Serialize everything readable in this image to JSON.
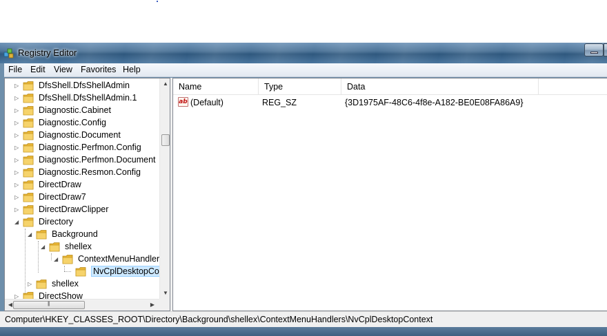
{
  "window": {
    "title": "Registry Editor"
  },
  "menu": [
    "File",
    "Edit",
    "View",
    "Favorites",
    "Help"
  ],
  "tree": {
    "items": [
      {
        "label": "DfsShell.DfsShellAdmin",
        "expander": "▷"
      },
      {
        "label": "DfsShell.DfsShellAdmin.1",
        "expander": "▷"
      },
      {
        "label": "Diagnostic.Cabinet",
        "expander": "▷"
      },
      {
        "label": "Diagnostic.Config",
        "expander": "▷"
      },
      {
        "label": "Diagnostic.Document",
        "expander": "▷"
      },
      {
        "label": "Diagnostic.Perfmon.Config",
        "expander": "▷"
      },
      {
        "label": "Diagnostic.Perfmon.Document",
        "expander": "▷"
      },
      {
        "label": "Diagnostic.Resmon.Config",
        "expander": "▷"
      },
      {
        "label": "DirectDraw",
        "expander": "▷"
      },
      {
        "label": "DirectDraw7",
        "expander": "▷"
      },
      {
        "label": "DirectDrawClipper",
        "expander": "▷"
      },
      {
        "label": "Directory",
        "expander": "◢"
      },
      {
        "label": "Background",
        "expander": "◢"
      },
      {
        "label": "shellex",
        "expander": "◢"
      },
      {
        "label": "ContextMenuHandlers",
        "expander": "◢"
      },
      {
        "label": "NvCplDesktopContext",
        "expander": ""
      },
      {
        "label": "shellex",
        "expander": "▷"
      },
      {
        "label": "DirectShow",
        "expander": "▷"
      }
    ]
  },
  "list": {
    "columns": [
      "Name",
      "Type",
      "Data"
    ],
    "rows": [
      {
        "name": "(Default)",
        "type": "REG_SZ",
        "data": "{3D1975AF-48C6-4f8e-A182-BE0E08FA86A9}"
      }
    ]
  },
  "status": {
    "path": "Computer\\HKEY_CLASSES_ROOT\\Directory\\Background\\shellex\\ContextMenuHandlers\\NvCplDesktopContext"
  },
  "scroll": {
    "up": "▲",
    "down": "▼",
    "left": "◀",
    "right": "▶",
    "grip": "|||"
  },
  "icons": {
    "app": "registry-icon",
    "folder": "folder-icon",
    "value": "string-value-icon",
    "value_glyph": "ab"
  },
  "colors": {
    "selection": "#cce8ff",
    "folder": "#f2c94c",
    "titlebar": "#4e7599"
  }
}
